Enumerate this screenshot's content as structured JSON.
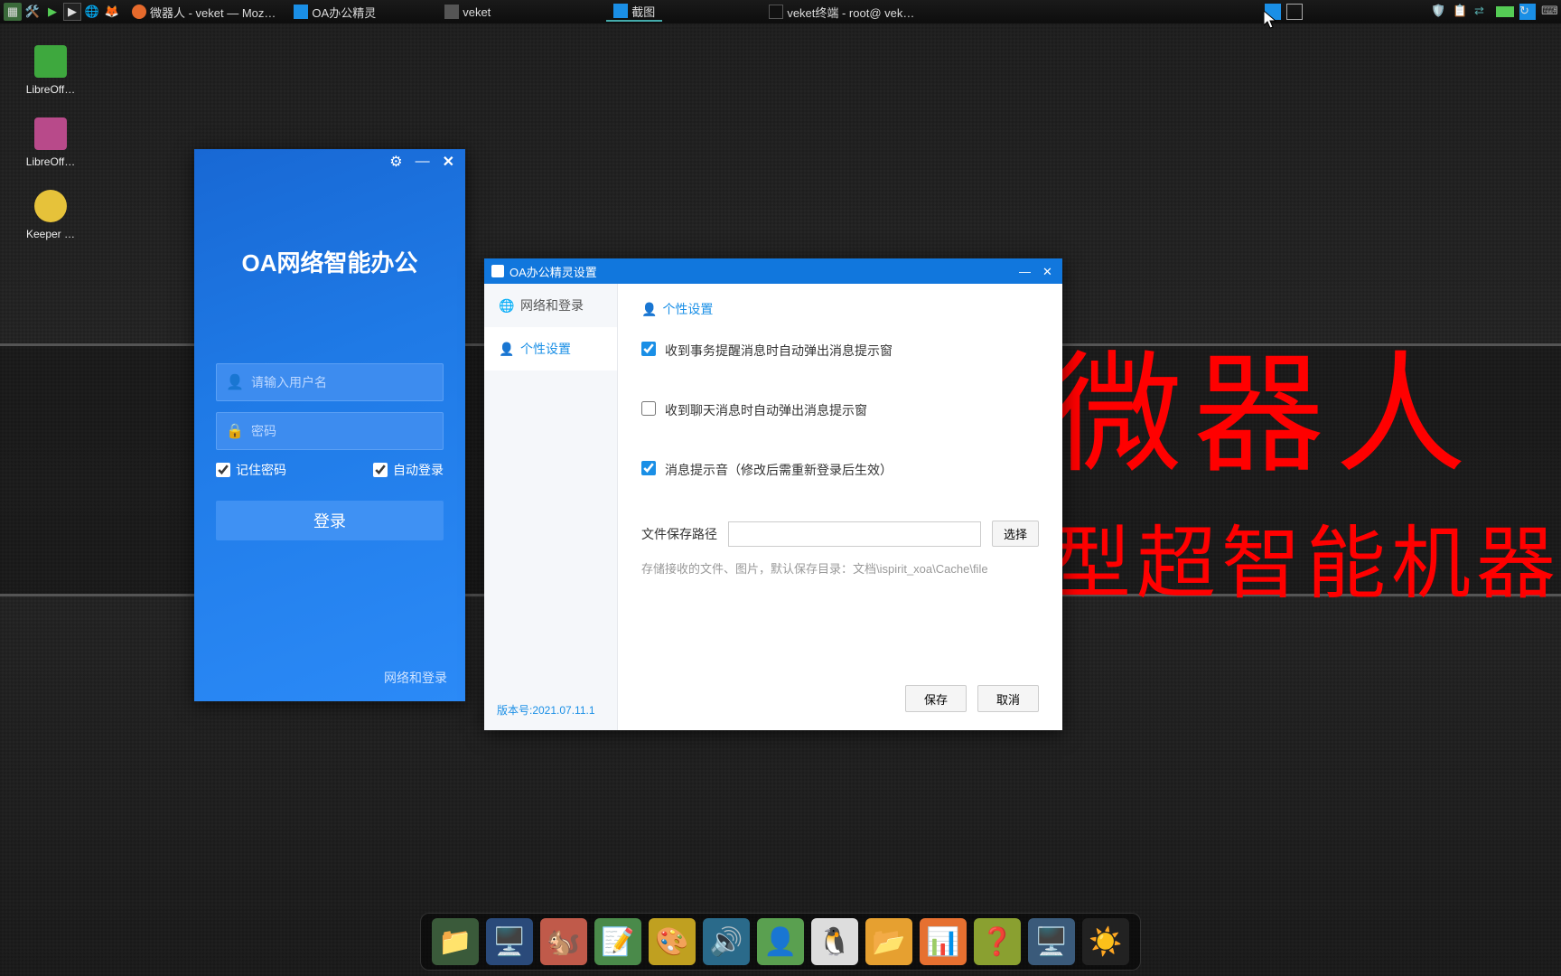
{
  "taskbar": {
    "tasks": [
      {
        "label": "微器人 - veket — Moz…",
        "color": "#e66a2c"
      },
      {
        "label": "OA办公精灵",
        "color": "#1a8fe6"
      },
      {
        "label": "veket",
        "color": "#333"
      },
      {
        "label": "截图",
        "color": "#1a8fe6",
        "active": true
      },
      {
        "label": "veket终端 - root@ vek…",
        "color": "#333"
      }
    ]
  },
  "desktop_icons": [
    {
      "label": "LibreOff…",
      "color": "#3ea83e"
    },
    {
      "label": "LibreOff…",
      "color": "#b84a8a"
    },
    {
      "label": "Keeper …",
      "color": "#e6c23a"
    }
  ],
  "bg_text": {
    "line1": "微器人",
    "line2": "型超智能机器"
  },
  "login": {
    "title": "OA网络智能办公",
    "username_placeholder": "请输入用户名",
    "password_placeholder": "密码",
    "remember": "记住密码",
    "autologin": "自动登录",
    "login_btn": "登录",
    "footer_link": "网络和登录"
  },
  "settings": {
    "title": "OA办公精灵设置",
    "nav": [
      {
        "label": "网络和登录",
        "active": false
      },
      {
        "label": "个性设置",
        "active": true
      }
    ],
    "section_title": "个性设置",
    "opts": [
      {
        "label": "收到事务提醒消息时自动弹出消息提示窗",
        "checked": true
      },
      {
        "label": "收到聊天消息时自动弹出消息提示窗",
        "checked": false
      },
      {
        "label": "消息提示音（修改后需重新登录后生效）",
        "checked": true
      }
    ],
    "path_label": "文件保存路径",
    "path_value": "",
    "browse": "选择",
    "path_hint": "存储接收的文件、图片，默认保存目录：文档\\ispirit_xoa\\Cache\\file",
    "save": "保存",
    "cancel": "取消",
    "version": "版本号:2021.07.11.1"
  },
  "dock": [
    {
      "name": "files",
      "bg": "#3a5a3a",
      "glyph": "📁"
    },
    {
      "name": "monitor",
      "bg": "#2a4a7a",
      "glyph": "🖥️"
    },
    {
      "name": "squirrel",
      "bg": "#c05a4a",
      "glyph": "🐿️"
    },
    {
      "name": "editor",
      "bg": "#4a8a4a",
      "glyph": "📝"
    },
    {
      "name": "paint",
      "bg": "#c0a020",
      "glyph": "🎨"
    },
    {
      "name": "media",
      "bg": "#2a6a8a",
      "glyph": "🔊"
    },
    {
      "name": "user",
      "bg": "#5aa050",
      "glyph": "👤"
    },
    {
      "name": "penguin",
      "bg": "#ddd",
      "glyph": "🐧"
    },
    {
      "name": "folder",
      "bg": "#e6a030",
      "glyph": "📂"
    },
    {
      "name": "chart",
      "bg": "#e67030",
      "glyph": "📊"
    },
    {
      "name": "help",
      "bg": "#8aa030",
      "glyph": "❓"
    },
    {
      "name": "display",
      "bg": "#3a5a7a",
      "glyph": "🖥️"
    },
    {
      "name": "brightness",
      "bg": "#222",
      "glyph": "☀️"
    }
  ]
}
